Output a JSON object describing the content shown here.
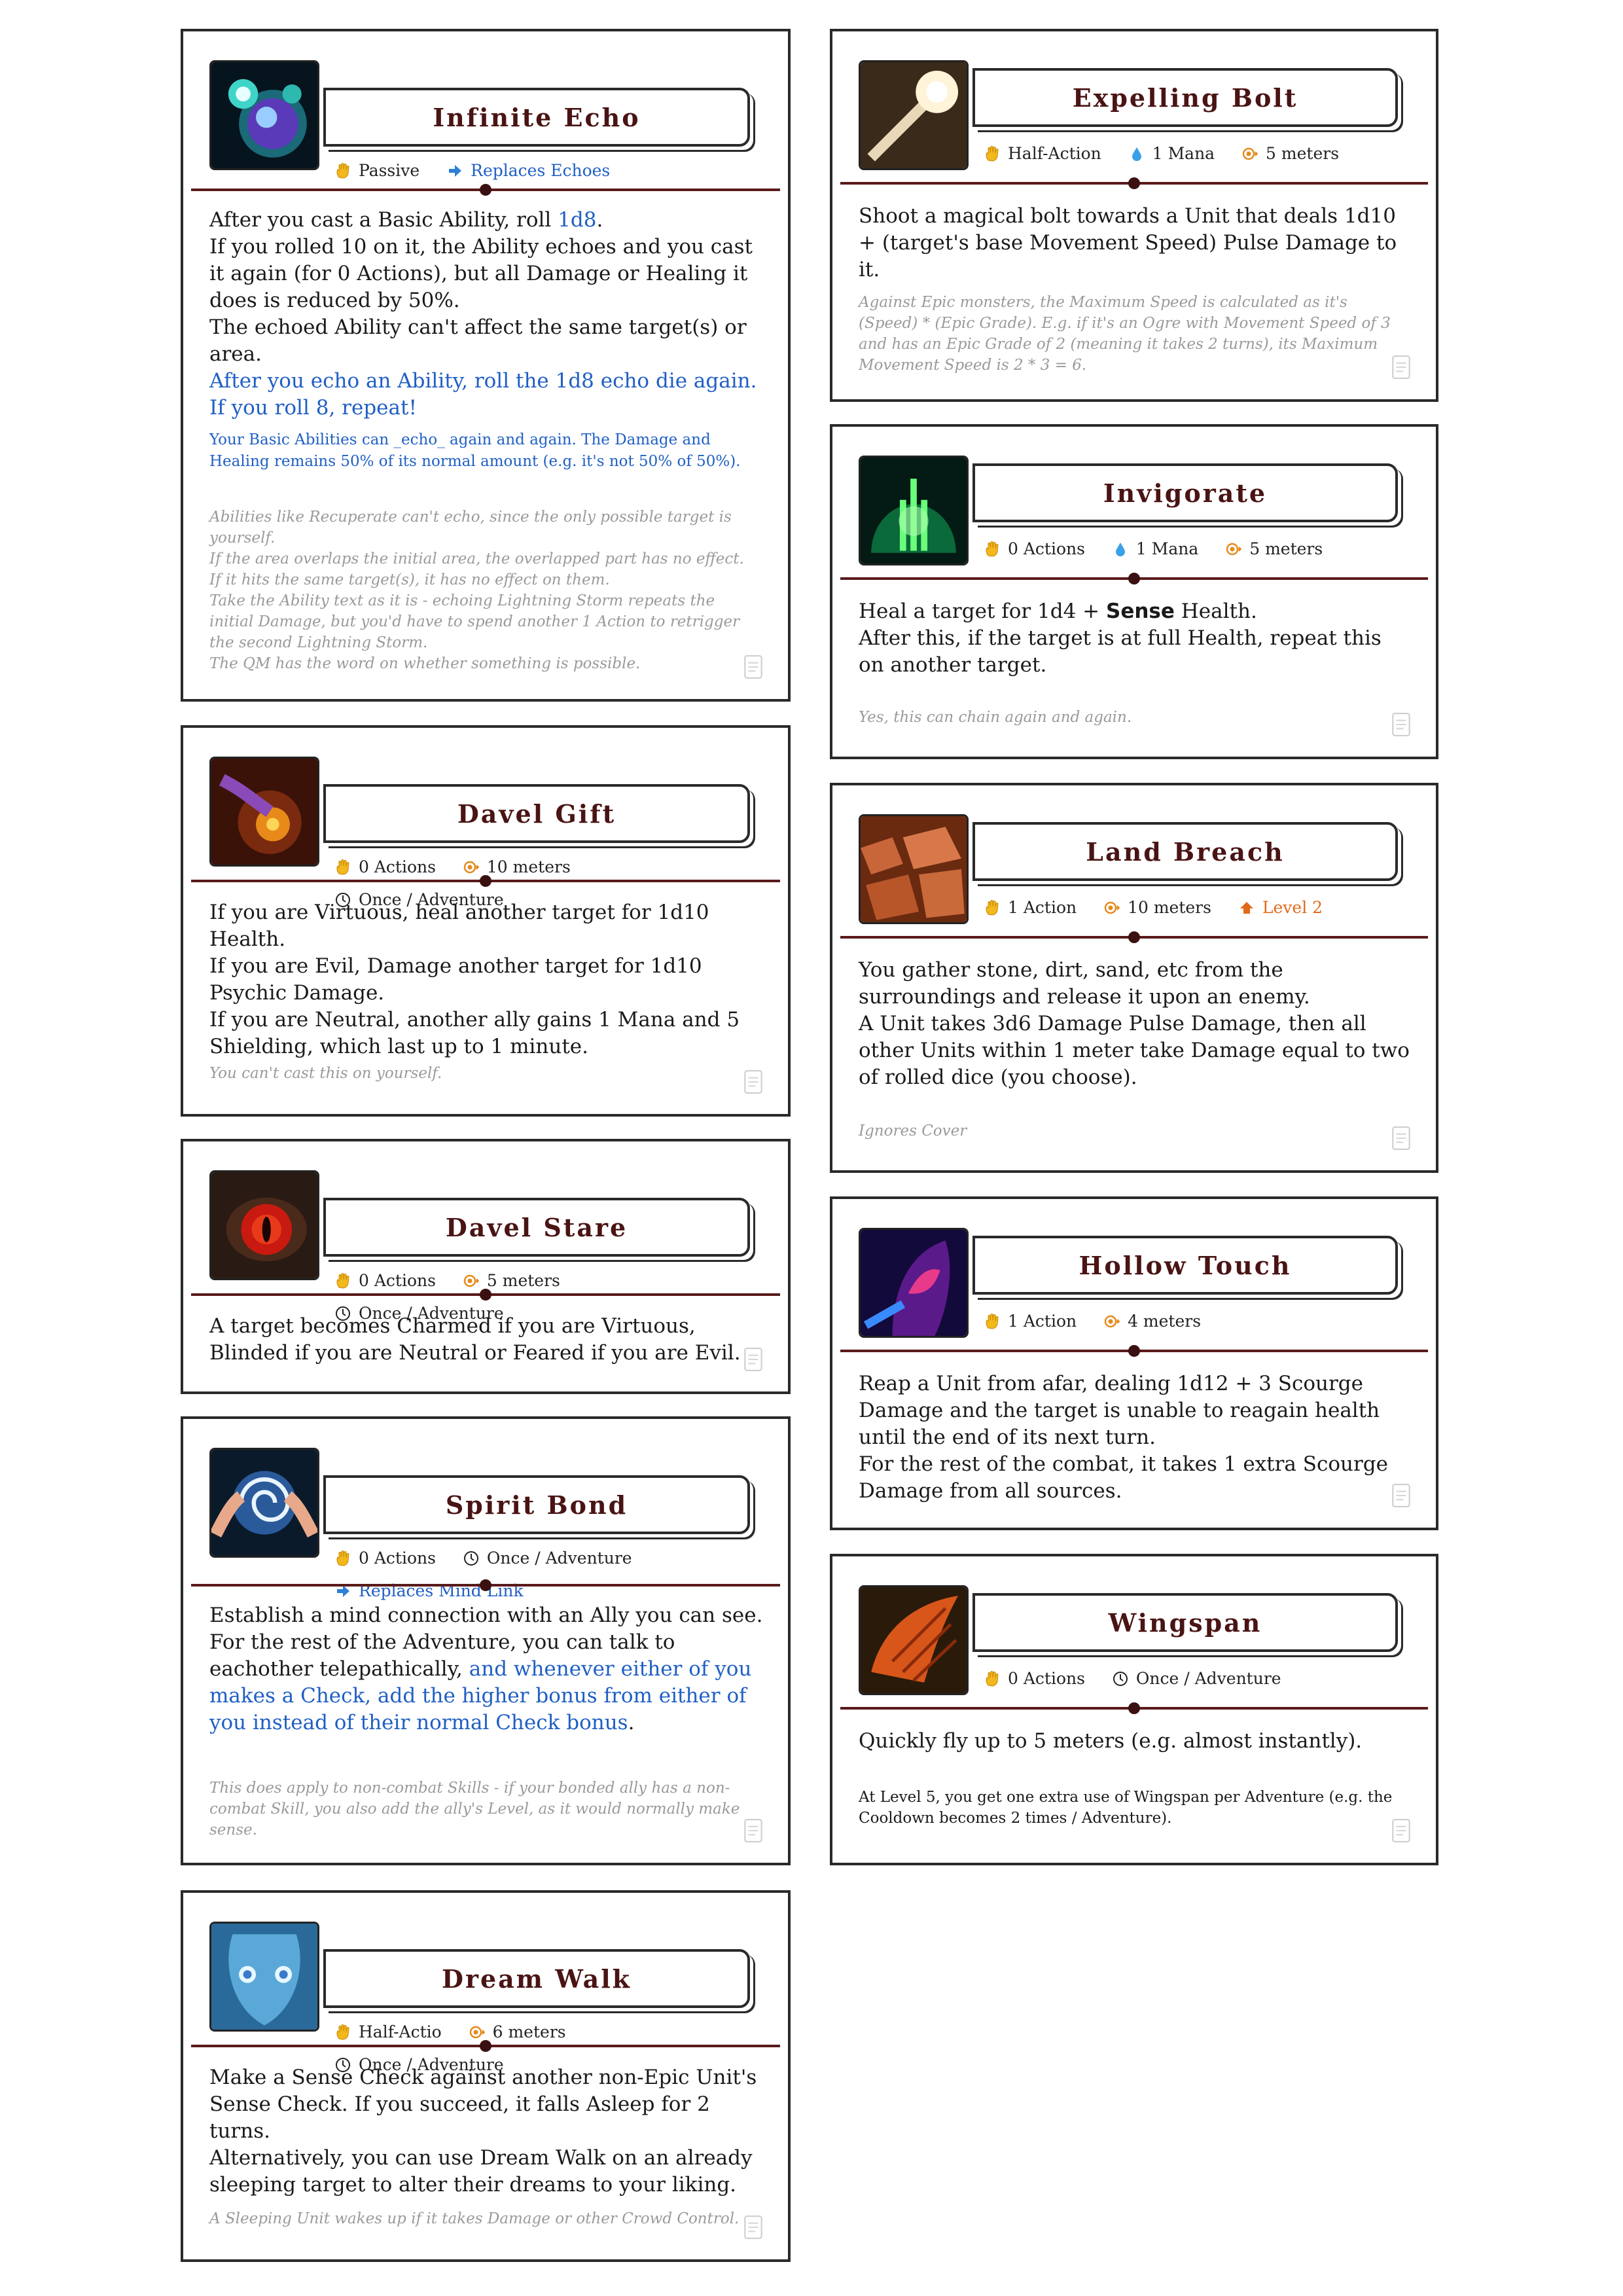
{
  "cards": [
    {
      "title": "Infinite Echo",
      "icon": "orb-echo-icon",
      "tags": [
        "Passive",
        "Replaces Echoes"
      ],
      "body": [
        "After you cast a Basic Ability, roll ",
        "1d8",
        ".",
        "If you rolled 10 on it, the Ability echoes and you cast it again (for 0 Actions), but all Damage or Healing it does is reduced by 50%.",
        "The echoed Ability can't affect the same target(s) or area.",
        "After you echo an Ability, roll the 1d8 echo die again. If you roll 8, repeat!"
      ],
      "note": "Your Basic Abilities can _echo_ again and again. The Damage and Healing remains 50% of its normal amount (e.g. it's not 50% of 50%).",
      "footer": [
        "Abilities like Recuperate can't echo, since the only possible target is yourself.",
        "If the area overlaps the initial area, the overlapped part has no effect. If it hits the same target(s), it has no effect on them.",
        "Take the Ability text as it is - echoing Lightning Storm repeats the initial Damage, but you'd have to spend another 1 Action to retrigger the second Lightning Storm.",
        "The QM has the word on whether something is possible."
      ]
    },
    {
      "title": "Davel Gift",
      "icon": "gift-hand-icon",
      "tags": [
        "0 Actions",
        "10 meters",
        "Once / Adventure"
      ],
      "body": [
        "If you are Virtuous, heal another target for 1d10 Health.",
        "If you are Evil, Damage another target for 1d10 Psychic Damage.",
        "If you are Neutral, another ally gains 1 Mana and 5 Shielding, which last up to 1 minute."
      ],
      "footer": [
        "You can't cast this on yourself."
      ]
    },
    {
      "title": "Davel Stare",
      "icon": "red-eye-icon",
      "tags": [
        "0 Actions",
        "5 meters",
        "Once / Adventure"
      ],
      "body": [
        "A target becomes Charmed if you are Virtuous, Blinded if you are Neutral or Feared if you are Evil."
      ]
    },
    {
      "title": "Spirit Bond",
      "icon": "spirit-hands-icon",
      "tags": [
        "0 Actions",
        "Once / Adventure",
        "Replaces Mind Link"
      ],
      "body": [
        "Establish a mind connection with an Ally you can see.",
        "For the rest of the Adventure, you can talk to eachother telepathically, ",
        "and whenever either of you makes a Check, add the higher bonus from either of you instead of their normal Check bonus",
        "."
      ],
      "footer": [
        "This does apply to non-combat Skills - if your bonded ally has a non-combat Skill, you also add the ally's Level, as it would normally make sense."
      ]
    },
    {
      "title": "Dream Walk",
      "icon": "blue-face-icon",
      "tags": [
        "Half-Actio",
        "6 meters",
        "Once / Adventure"
      ],
      "body": [
        "Make a Sense Check against another non-Epic Unit's Sense Check. If you succeed, it falls Asleep for 2 turns.",
        "Alternatively, you can use Dream Walk on an already sleeping target to alter their dreams to your liking."
      ],
      "footer": [
        "A Sleeping Unit wakes up if it takes Damage or other Crowd Control."
      ]
    },
    {
      "title": "Expelling Bolt",
      "icon": "bolt-icon",
      "tags": [
        "Half-Action",
        "1 Mana",
        "5 meters"
      ],
      "body": [
        "Shoot a magical bolt towards a Unit that deals 1d10 + (target's base Movement Speed) Pulse Damage to it."
      ],
      "footer": [
        "Against Epic monsters, the Maximum Speed is calculated as it's (Speed) * (Epic Grade). E.g. if it's an Ogre with Movement Speed of 3 and has an Epic Grade of 2 (meaning it takes 2 turns), its Maximum Movement Speed is 2 * 3 = 6."
      ]
    },
    {
      "title": "Invigorate",
      "icon": "green-dome-icon",
      "tags": [
        "0 Actions",
        "1 Mana",
        "5 meters"
      ],
      "body": [
        "Heal a target for 1d4 + ",
        "Sense",
        " Health.",
        "After this, if the target is at full Health, repeat this on another target."
      ],
      "footer": [
        "Yes, this can chain again and again."
      ]
    },
    {
      "title": "Land Breach",
      "icon": "rocks-icon",
      "tags": [
        "1 Action",
        "10 meters",
        "Level 2"
      ],
      "body": [
        "You gather stone, dirt, sand, etc from the surroundings and release it upon an enemy.",
        "A Unit takes 3d6 Damage Pulse Damage, then all other Units within 1 meter take Damage equal to two of rolled dice (you choose)."
      ],
      "footer": [
        "Ignores Cover"
      ]
    },
    {
      "title": "Hollow Touch",
      "icon": "hooded-figure-icon",
      "tags": [
        "1 Action",
        "4 meters"
      ],
      "body": [
        "Reap a Unit from afar, dealing 1d12 + 3 Scourge Damage and the target is unable to reagain health until the end of its next turn.",
        "For the rest of the combat, it takes 1 extra Scourge Damage from all sources."
      ]
    },
    {
      "title": "Wingspan",
      "icon": "wing-icon",
      "tags": [
        "0 Actions",
        "Once / Adventure"
      ],
      "body": [
        "Quickly fly up to 5 meters (e.g. almost instantly)."
      ],
      "note": "At Level 5, you get one extra use of Wingspan per Adventure (e.g. the Cooldown becomes 2 times / Adventure)."
    }
  ]
}
